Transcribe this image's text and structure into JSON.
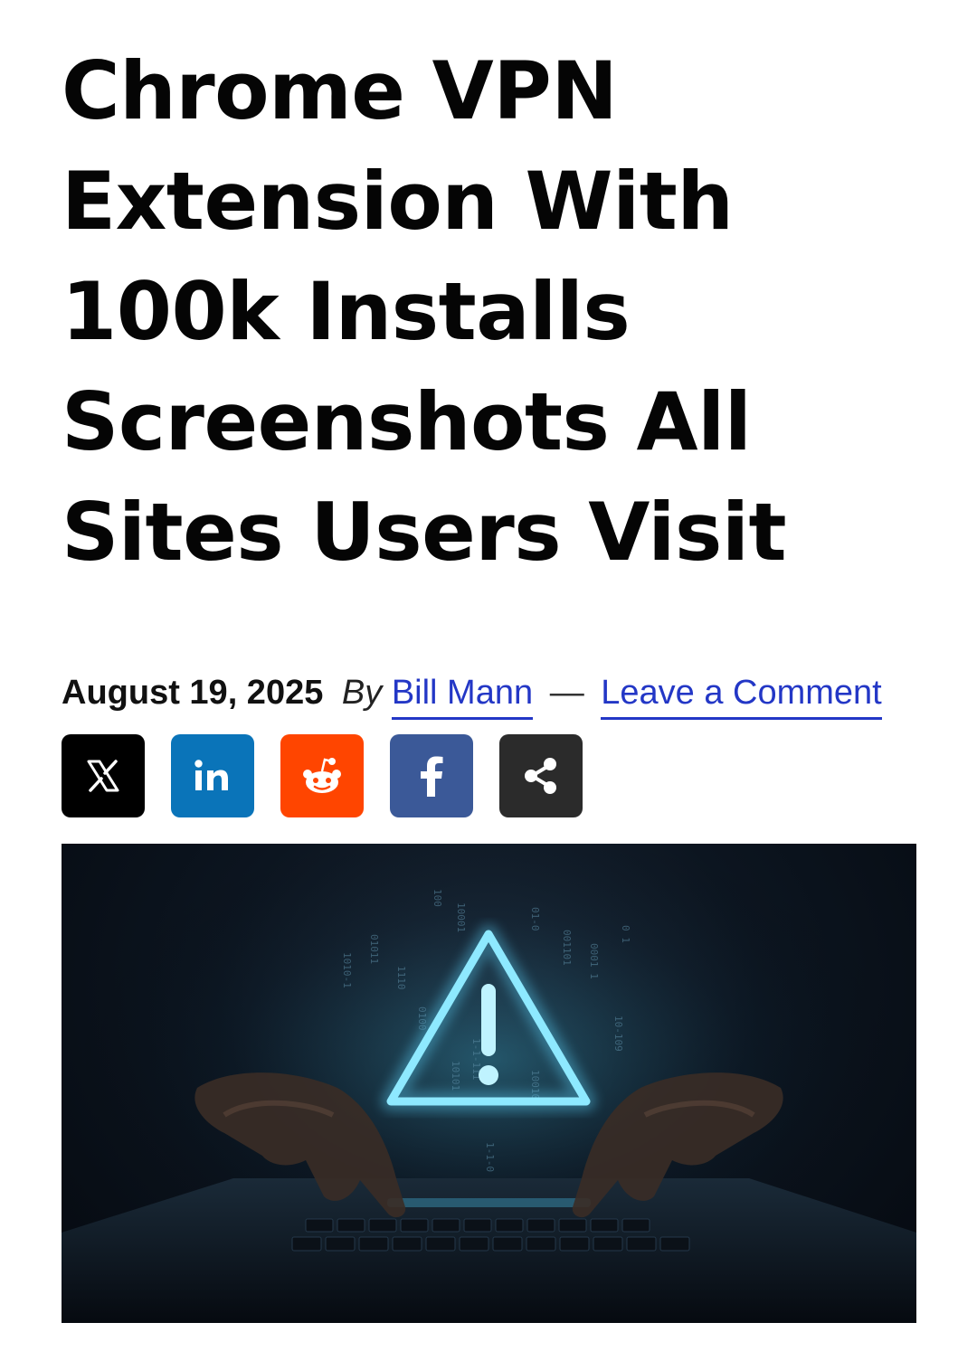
{
  "article": {
    "title_lines": [
      "Chrome VPN",
      "Extension With",
      "100k Installs",
      "Screenshots All",
      "Sites Users Visit"
    ],
    "date": "August 19, 2025",
    "by_label": "By",
    "author": "Bill Mann",
    "separator": "—",
    "comment_link": "Leave a Comment"
  },
  "share_buttons": [
    {
      "name": "x",
      "icon": "x-logo-icon",
      "color": "#000000"
    },
    {
      "name": "linkedin",
      "icon": "linkedin-icon",
      "color": "#0a66c2"
    },
    {
      "name": "reddit",
      "icon": "reddit-icon",
      "color": "#ff4500"
    },
    {
      "name": "facebook",
      "icon": "facebook-icon",
      "color": "#3b5998"
    },
    {
      "name": "share",
      "icon": "share-icon",
      "color": "#2b2b2b"
    }
  ],
  "hero_image": {
    "subject": "warning-triangle-over-keyboard",
    "accent_color": "#7fe3ff"
  }
}
